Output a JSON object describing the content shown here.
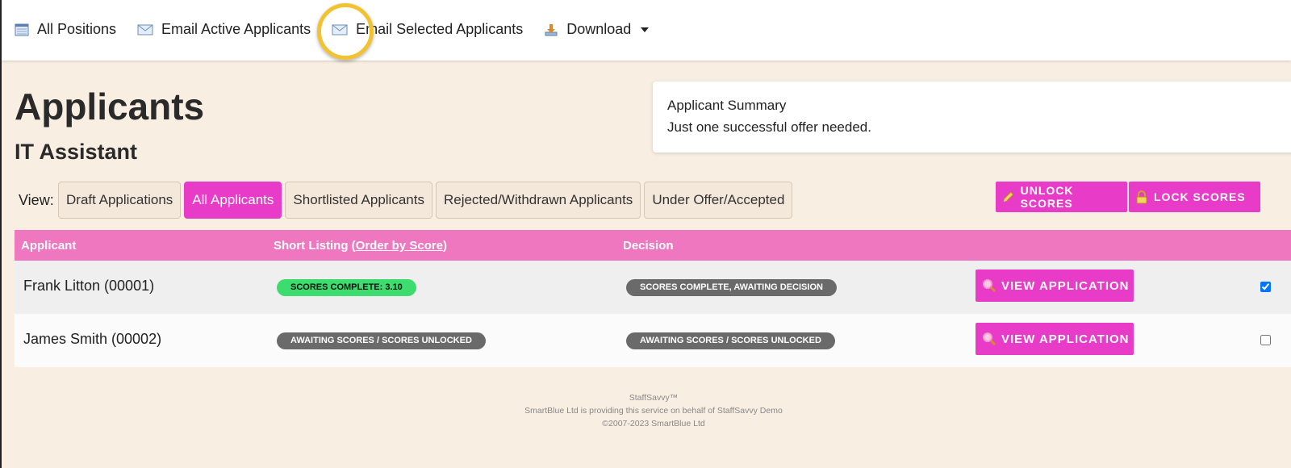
{
  "topnav": {
    "items": [
      {
        "label": "All Positions",
        "icon": "calendar-icon"
      },
      {
        "label": "Email Active Applicants",
        "icon": "envelope-icon"
      },
      {
        "label": "Email Selected Applicants",
        "icon": "envelope-icon"
      },
      {
        "label": "Download",
        "icon": "download-icon"
      }
    ]
  },
  "page": {
    "title": "Applicants",
    "position": "IT Assistant"
  },
  "summary": {
    "title": "Applicant Summary",
    "text": "Just one successful offer needed."
  },
  "view": {
    "label": "View:",
    "tabs": [
      {
        "label": "Draft Applications",
        "active": false
      },
      {
        "label": "All Applicants",
        "active": true
      },
      {
        "label": "Shortlisted Applicants",
        "active": false
      },
      {
        "label": "Rejected/Withdrawn Applicants",
        "active": false
      },
      {
        "label": "Under Offer/Accepted",
        "active": false
      }
    ]
  },
  "score_buttons": {
    "unlock": "UNLOCK SCORES",
    "lock": "LOCK SCORES"
  },
  "table": {
    "headers": {
      "applicant": "Applicant",
      "short_listing": "Short Listing (",
      "order_by_score": "Order by Score",
      "short_listing_close": ")",
      "decision": "Decision"
    },
    "rows": [
      {
        "name": "Frank Litton (00001)",
        "short_listing": "SCORES COMPLETE: 3.10",
        "decision": "SCORES COMPLETE, AWAITING DECISION",
        "action": "VIEW APPLICATION",
        "selected": true
      },
      {
        "name": "James Smith (00002)",
        "short_listing": "AWAITING SCORES / SCORES UNLOCKED",
        "decision": "AWAITING SCORES / SCORES UNLOCKED",
        "action": "VIEW APPLICATION",
        "selected": false
      }
    ]
  },
  "footer": {
    "brand": "StaffSavvy™",
    "line1": "SmartBlue Ltd is providing this service on behalf of StaffSavvy Demo",
    "line2": "©2007-2023 SmartBlue Ltd"
  },
  "colors": {
    "accent": "#e83cc8",
    "table_header": "#ee77c0",
    "background": "#f8eee1",
    "badge_green": "#3ddc6e",
    "badge_grey": "#6a6a6a",
    "highlight_ring": "#f1c232"
  }
}
